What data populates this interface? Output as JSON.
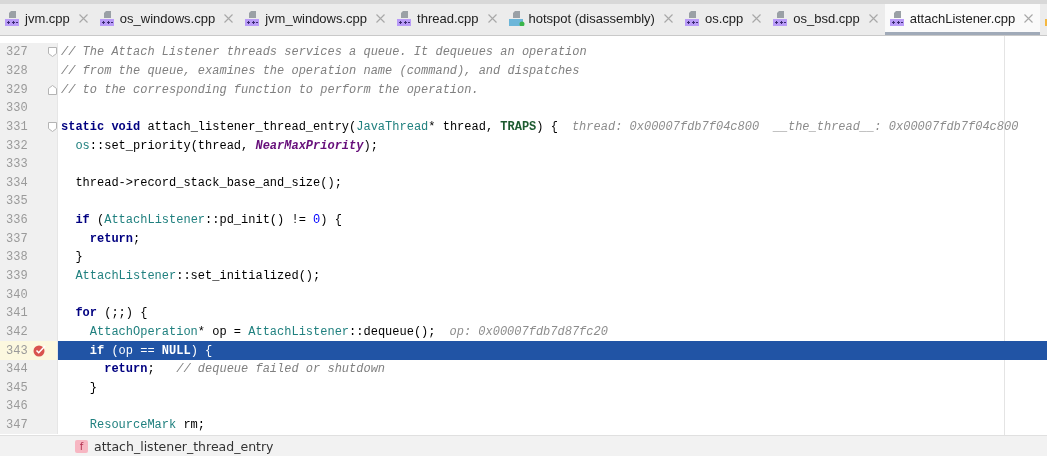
{
  "tabs": [
    {
      "label": "jvm.cpp",
      "kind": "cpp",
      "selected": false
    },
    {
      "label": "os_windows.cpp",
      "kind": "cpp",
      "selected": false
    },
    {
      "label": "jvm_windows.cpp",
      "kind": "cpp",
      "selected": false
    },
    {
      "label": "thread.cpp",
      "kind": "cpp",
      "selected": false
    },
    {
      "label": "hotspot (disassembly)",
      "kind": "disasm",
      "selected": false
    },
    {
      "label": "os.cpp",
      "kind": "cpp",
      "selected": false
    },
    {
      "label": "os_bsd.cpp",
      "kind": "cpp",
      "selected": false
    },
    {
      "label": "attachListener.cpp",
      "kind": "cpp",
      "selected": true
    },
    {
      "kind": "header",
      "selected": false
    }
  ],
  "editor": {
    "lines": [
      {
        "number": "327",
        "current": false,
        "breakpoint": false,
        "fold_start": true,
        "fold_end": false,
        "tokens": [
          {
            "text": "// The Attach Listener threads services a queue. It dequeues an operation",
            "kind": "comment"
          }
        ]
      },
      {
        "number": "328",
        "current": false,
        "breakpoint": false,
        "fold_start": false,
        "fold_end": false,
        "tokens": [
          {
            "text": "// from the queue, examines the operation name (command), and dispatches",
            "kind": "comment"
          }
        ]
      },
      {
        "number": "329",
        "current": false,
        "breakpoint": false,
        "fold_start": false,
        "fold_end": true,
        "tokens": [
          {
            "text": "// to the corresponding function to perform the operation.",
            "kind": "comment"
          }
        ]
      },
      {
        "number": "330",
        "current": false,
        "breakpoint": false,
        "fold_start": false,
        "fold_end": false
      },
      {
        "number": "331",
        "current": false,
        "breakpoint": false,
        "fold_start": true,
        "fold_end": false,
        "tokens": [
          {
            "text": "static void",
            "kind": "keyword"
          },
          {
            "text": " attach_listener_thread_entry(",
            "kind": "plain"
          },
          {
            "text": "JavaThread",
            "kind": "type"
          },
          {
            "text": "* thread, ",
            "kind": "plain"
          },
          {
            "text": "TRAPS",
            "kind": "macro"
          },
          {
            "text": ") {",
            "kind": "plain"
          }
        ],
        "hint": "thread: 0x00007fdb7f04c800  __the_thread__: 0x00007fdb7f04c800"
      },
      {
        "number": "332",
        "current": false,
        "breakpoint": false,
        "fold_start": false,
        "fold_end": false,
        "tokens": [
          {
            "text": "  os",
            "kind": "type"
          },
          {
            "text": "::set_priority(thread, ",
            "kind": "plain"
          },
          {
            "text": "NearMaxPriority",
            "kind": "constant"
          },
          {
            "text": ");",
            "kind": "plain"
          }
        ]
      },
      {
        "number": "333",
        "current": false,
        "breakpoint": false,
        "fold_start": false,
        "fold_end": false
      },
      {
        "number": "334",
        "current": false,
        "breakpoint": false,
        "fold_start": false,
        "fold_end": false,
        "tokens": [
          {
            "text": "  thread->record_stack_base_and_size();",
            "kind": "plain"
          }
        ]
      },
      {
        "number": "335",
        "current": false,
        "breakpoint": false,
        "fold_start": false,
        "fold_end": false
      },
      {
        "number": "336",
        "current": false,
        "breakpoint": false,
        "fold_start": false,
        "fold_end": false,
        "tokens": [
          {
            "text": "  if",
            "kind": "keyword"
          },
          {
            "text": " (",
            "kind": "plain"
          },
          {
            "text": "AttachListener",
            "kind": "type"
          },
          {
            "text": "::pd_init() != ",
            "kind": "plain"
          },
          {
            "text": "0",
            "kind": "number"
          },
          {
            "text": ") {",
            "kind": "plain"
          }
        ]
      },
      {
        "number": "337",
        "current": false,
        "breakpoint": false,
        "fold_start": false,
        "fold_end": false,
        "tokens": [
          {
            "text": "    return",
            "kind": "keyword"
          },
          {
            "text": ";",
            "kind": "plain"
          }
        ]
      },
      {
        "number": "338",
        "current": false,
        "breakpoint": false,
        "fold_start": false,
        "fold_end": false,
        "tokens": [
          {
            "text": "  }",
            "kind": "plain"
          }
        ]
      },
      {
        "number": "339",
        "current": false,
        "breakpoint": false,
        "fold_start": false,
        "fold_end": false,
        "tokens": [
          {
            "text": "  AttachListener",
            "kind": "type"
          },
          {
            "text": "::set_initialized();",
            "kind": "plain"
          }
        ]
      },
      {
        "number": "340",
        "current": false,
        "breakpoint": false,
        "fold_start": false,
        "fold_end": false
      },
      {
        "number": "341",
        "current": false,
        "breakpoint": false,
        "fold_start": false,
        "fold_end": false,
        "tokens": [
          {
            "text": "  for",
            "kind": "keyword"
          },
          {
            "text": " (;;) {",
            "kind": "plain"
          }
        ]
      },
      {
        "number": "342",
        "current": false,
        "breakpoint": false,
        "fold_start": false,
        "fold_end": false,
        "tokens": [
          {
            "text": "    AttachOperation",
            "kind": "type"
          },
          {
            "text": "* op = ",
            "kind": "plain"
          },
          {
            "text": "AttachListener",
            "kind": "type"
          },
          {
            "text": "::dequeue();",
            "kind": "plain"
          }
        ],
        "hint": "op: 0x00007fdb7d87fc20"
      },
      {
        "number": "343",
        "current": true,
        "breakpoint": true,
        "fold_start": false,
        "fold_end": false,
        "tokens": [
          {
            "text": "    if",
            "kind": "keyword"
          },
          {
            "text": " (op == ",
            "kind": "plain"
          },
          {
            "text": "NULL",
            "kind": "keyword"
          },
          {
            "text": ") {",
            "kind": "plain"
          }
        ]
      },
      {
        "number": "344",
        "current": false,
        "breakpoint": false,
        "fold_start": false,
        "fold_end": false,
        "tokens": [
          {
            "text": "      return",
            "kind": "keyword"
          },
          {
            "text": ";   ",
            "kind": "plain"
          },
          {
            "text": "// dequeue failed or shutdown",
            "kind": "comment"
          }
        ]
      },
      {
        "number": "345",
        "current": false,
        "breakpoint": false,
        "fold_start": false,
        "fold_end": false,
        "tokens": [
          {
            "text": "    }",
            "kind": "plain"
          }
        ]
      },
      {
        "number": "346",
        "current": false,
        "breakpoint": false,
        "fold_start": false,
        "fold_end": false
      },
      {
        "number": "347",
        "current": false,
        "breakpoint": false,
        "fold_start": false,
        "fold_end": false,
        "tokens": [
          {
            "text": "    ResourceMark",
            "kind": "type"
          },
          {
            "text": " rm;",
            "kind": "plain"
          }
        ]
      }
    ]
  },
  "breadcrumb": {
    "badge": "f",
    "label": "attach_listener_thread_entry"
  }
}
